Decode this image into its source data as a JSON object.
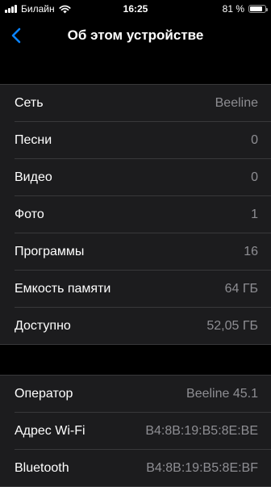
{
  "status_bar": {
    "carrier": "Билайн",
    "time": "16:25",
    "battery_text": "81 %",
    "battery_level": 0.81,
    "signal_bars": 4
  },
  "nav": {
    "title": "Об этом устройстве",
    "back_icon": "chevron-left-icon",
    "accent_color": "#0a84ff"
  },
  "group1": [
    {
      "label": "Сеть",
      "value": "Beeline"
    },
    {
      "label": "Песни",
      "value": "0"
    },
    {
      "label": "Видео",
      "value": "0"
    },
    {
      "label": "Фото",
      "value": "1"
    },
    {
      "label": "Программы",
      "value": "16"
    },
    {
      "label": "Емкость памяти",
      "value": "64 ГБ"
    },
    {
      "label": "Доступно",
      "value": "52,05 ГБ"
    }
  ],
  "group2": [
    {
      "label": "Оператор",
      "value": "Beeline 45.1"
    },
    {
      "label": "Адрес Wi-Fi",
      "value": "B4:8B:19:B5:8E:BE"
    },
    {
      "label": "Bluetooth",
      "value": "B4:8B:19:B5:8E:BF"
    }
  ]
}
